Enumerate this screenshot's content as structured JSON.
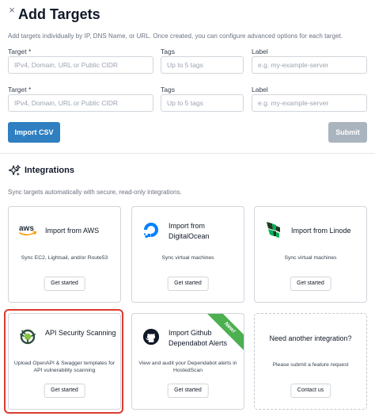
{
  "header": {
    "close_icon": "×",
    "title": "Add Targets",
    "subtitle": "Add targets individually by IP, DNS Name, or URL. Once created, you can configure advanced options for each target."
  },
  "target_rows": [
    {
      "target_label": "Target *",
      "target_placeholder": "IPv4, Domain, URL or Public CIDR",
      "tags_label": "Tags",
      "tags_placeholder": "Up to 5 tags",
      "label_label": "Label",
      "label_placeholder": "e.g. my-example-server"
    },
    {
      "target_label": "Target *",
      "target_placeholder": "IPv4, Domain, URL or Public CIDR",
      "tags_label": "Tags",
      "tags_placeholder": "Up to 5 tags",
      "label_label": "Label",
      "label_placeholder": "e.g. my-example-server"
    }
  ],
  "actions": {
    "import_csv": "Import CSV",
    "submit": "Submit"
  },
  "integrations": {
    "icon": "sparkle-icon",
    "title": "Integrations",
    "subtitle": "Sync targets automatically with secure, read-only integrations.",
    "cards": [
      {
        "icon": "aws-logo-icon",
        "title": "Import from AWS",
        "description": "Sync EC2, Lightsail, and/or Route53",
        "button": "Get started"
      },
      {
        "icon": "digitalocean-logo-icon",
        "title": "Import from DigitalOcean",
        "description": "Sync virtual machines",
        "button": "Get started"
      },
      {
        "icon": "linode-logo-icon",
        "title": "Import from Linode",
        "description": "Sync virtual machines",
        "button": "Get started"
      },
      {
        "icon": "api-security-icon",
        "title": "API Security Scanning",
        "description": "Upload OpenAPI & Swagger templates for API vulnerability scanning",
        "button": "Get started"
      },
      {
        "icon": "github-logo-icon",
        "title": "Import Github Dependabot Alerts",
        "description": "View and audit your Dependabot alerts in HostedScan",
        "button": "Get started",
        "badge": "New!"
      },
      {
        "title": "Need another integration?",
        "description": "Please submit a feature request",
        "button": "Contact us"
      }
    ]
  },
  "colors": {
    "primary": "#2f7fc1",
    "disabled": "#aab4be",
    "highlight": "#dc3b2e",
    "badge": "#4caf50"
  }
}
